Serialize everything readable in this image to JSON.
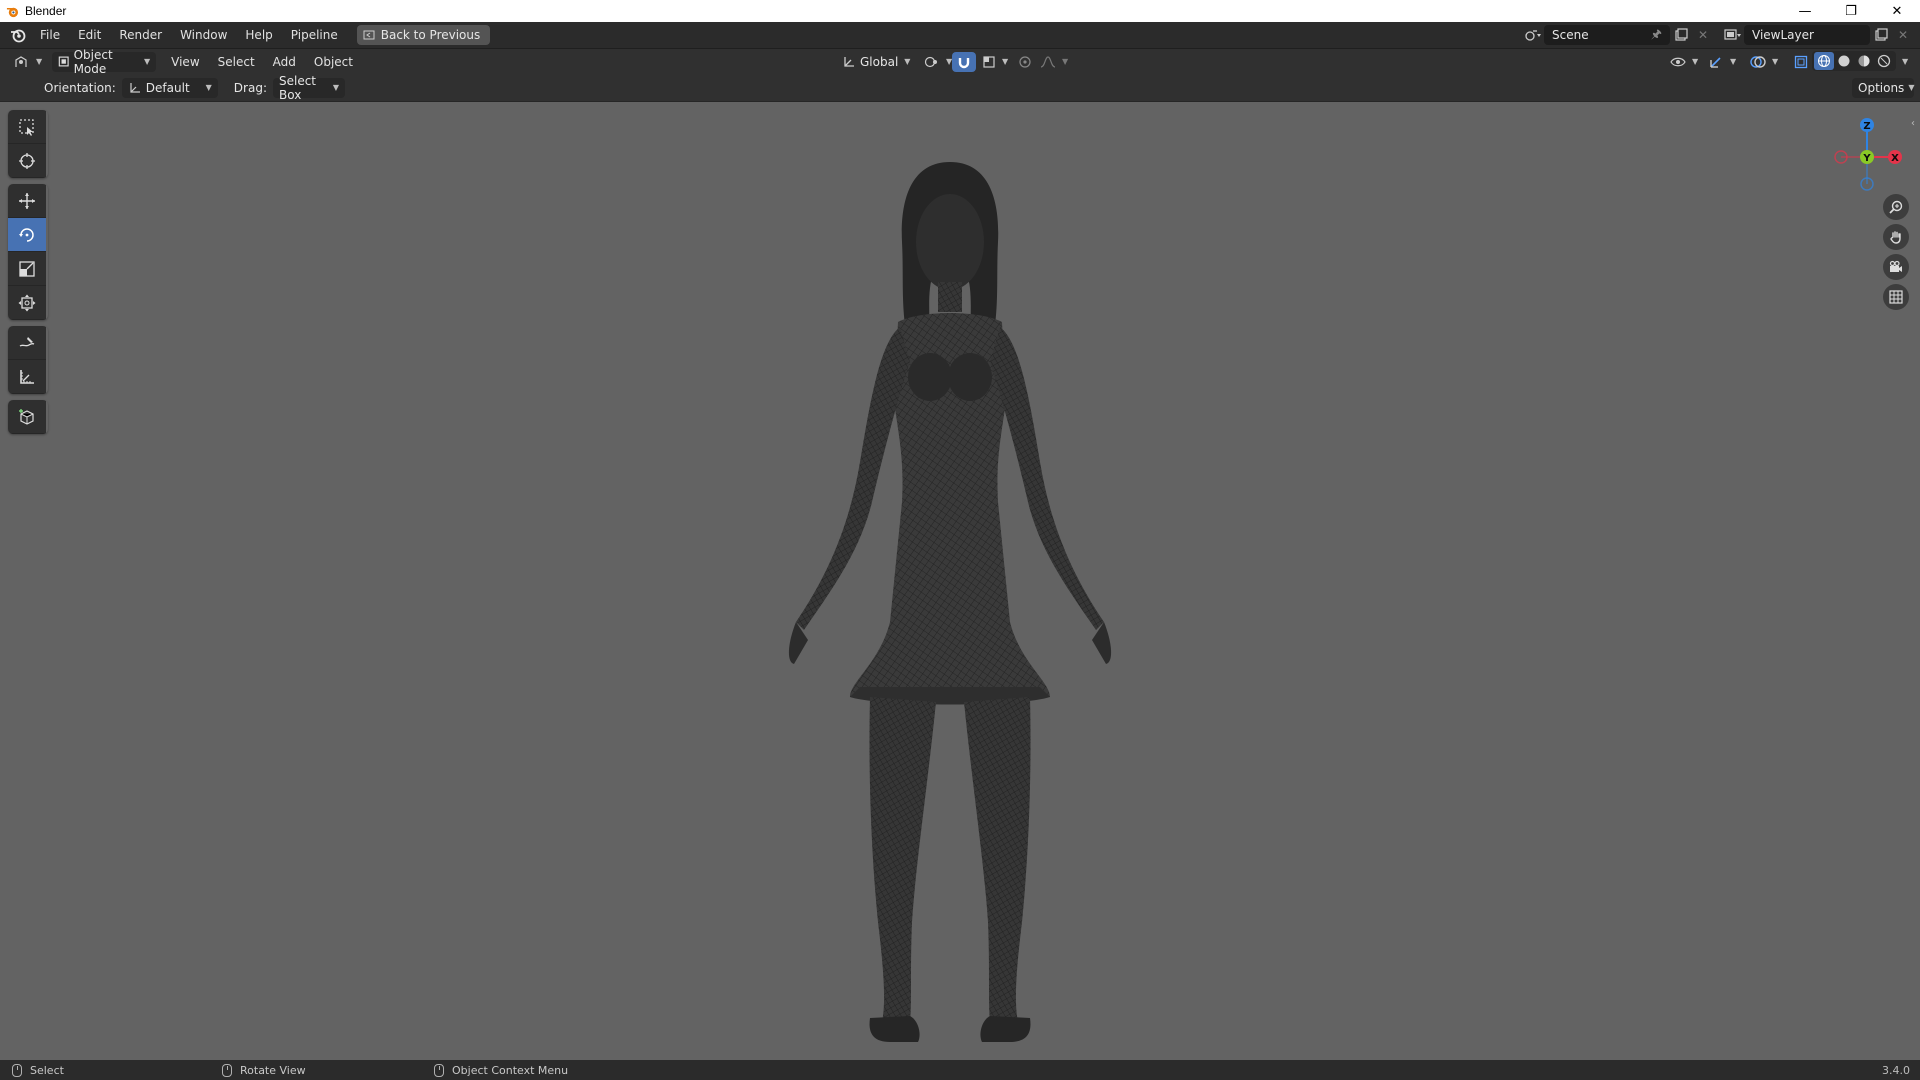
{
  "window": {
    "title": "Blender",
    "controls": [
      "minimize-icon",
      "restore-icon",
      "close-icon"
    ]
  },
  "topbar": {
    "menus": [
      "File",
      "Edit",
      "Render",
      "Window",
      "Help",
      "Pipeline"
    ],
    "back_button": "Back to Previous",
    "scene": "Scene",
    "view_layer": "ViewLayer"
  },
  "header": {
    "mode": "Object Mode",
    "menus": [
      "View",
      "Select",
      "Add",
      "Object"
    ],
    "transform_orientation": "Global"
  },
  "tool_settings": {
    "orientation_label": "Orientation:",
    "orientation_value": "Default",
    "drag_label": "Drag:",
    "drag_value": "Select Box",
    "options": "Options"
  },
  "gizmo": {
    "z": "Z",
    "y": "Y",
    "x": "X"
  },
  "toolbar": {
    "tools": [
      "select-box-tool",
      "cursor-tool",
      "move-tool",
      "rotate-tool",
      "scale-tool",
      "transform-tool",
      "annotate-tool",
      "measure-tool",
      "add-cube-tool"
    ],
    "active": "rotate-tool"
  },
  "statusbar": {
    "select": "Select",
    "rotate_view": "Rotate View",
    "context_menu": "Object Context Menu",
    "version": "3.4.0"
  },
  "colors": {
    "viewport_bg": "#636363",
    "accent": "#4772b3",
    "axis_x": "#e4344a",
    "axis_y": "#8ac926",
    "axis_z": "#2f84e3"
  }
}
